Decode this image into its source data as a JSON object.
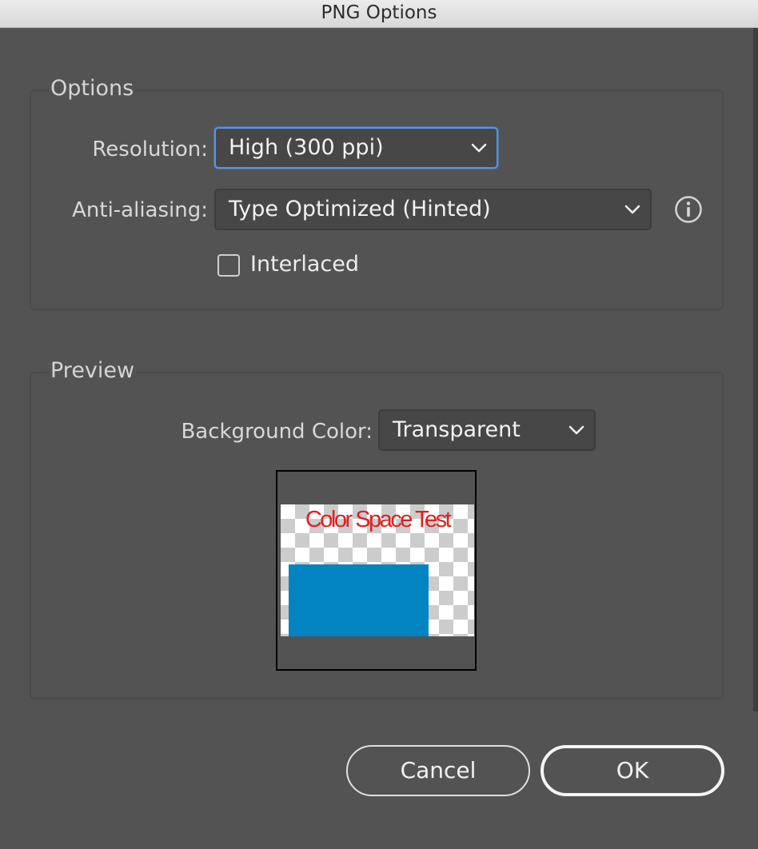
{
  "window": {
    "title": "PNG Options"
  },
  "options": {
    "group_title": "Options",
    "resolution": {
      "label": "Resolution:",
      "value": "High (300 ppi)"
    },
    "anti_aliasing": {
      "label": "Anti-aliasing:",
      "value": "Type Optimized (Hinted)"
    },
    "interlaced": {
      "label": "Interlaced",
      "checked": false
    }
  },
  "preview": {
    "group_title": "Preview",
    "background_color": {
      "label": "Background Color:",
      "value": "Transparent"
    },
    "thumbnail": {
      "text": "Color Space Test",
      "text_color": "#e02020",
      "rect_color": "#0284c0"
    }
  },
  "buttons": {
    "cancel": "Cancel",
    "ok": "OK"
  },
  "colors": {
    "focus_ring": "#5f93d6",
    "dialog_bg": "#535353"
  }
}
